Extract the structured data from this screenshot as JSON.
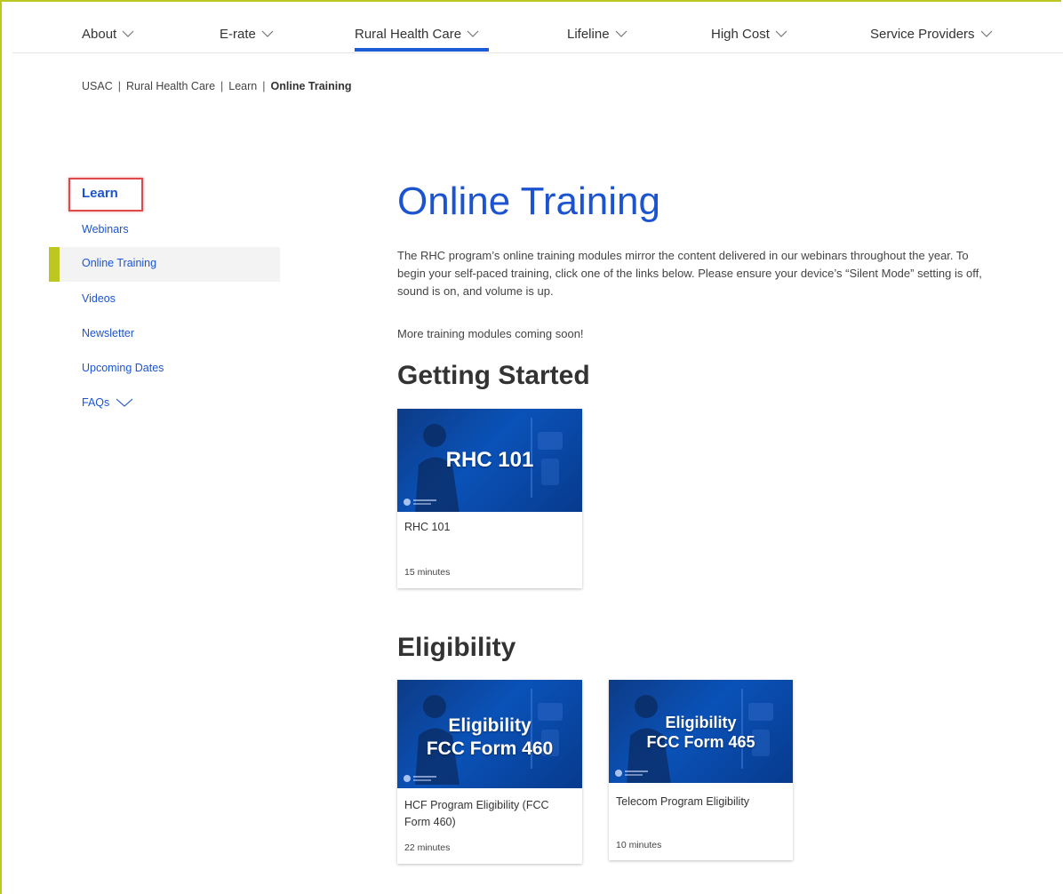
{
  "nav": {
    "items": [
      {
        "label": "About"
      },
      {
        "label": "E-rate"
      },
      {
        "label": "Rural Health Care"
      },
      {
        "label": "Lifeline"
      },
      {
        "label": "High Cost"
      },
      {
        "label": "Service Providers"
      }
    ],
    "active_index": 2
  },
  "breadcrumb": {
    "items": [
      "USAC",
      "Rural Health Care",
      "Learn"
    ],
    "separator": "|",
    "current": "Online Training"
  },
  "sidebar": {
    "heading": "Learn",
    "items": [
      {
        "label": "Webinars"
      },
      {
        "label": "Online Training"
      },
      {
        "label": "Videos"
      },
      {
        "label": "Newsletter"
      },
      {
        "label": "Upcoming Dates"
      },
      {
        "label": "FAQs"
      }
    ]
  },
  "main": {
    "title": "Online Training",
    "intro": "The RHC program’s online training modules mirror the content delivered in our webinars throughout the year. To begin your self-paced training, click one of the links below. Please ensure your device’s “Silent Mode” setting is off, sound is on, and volume is up.",
    "coming_soon": "More training modules coming soon!",
    "sections": [
      {
        "title": "Getting Started",
        "cards": [
          {
            "thumb_line1": "RHC 101",
            "thumb_line2": "",
            "label": "RHC 101",
            "duration": "15 minutes"
          }
        ]
      },
      {
        "title": "Eligibility",
        "cards": [
          {
            "thumb_line1": "Eligibility",
            "thumb_line2": "FCC Form 460",
            "label": "HCF Program Eligibility (FCC Form 460)",
            "duration": "22 minutes"
          },
          {
            "thumb_line1": "Eligibility",
            "thumb_line2": "FCC Form 465",
            "label": "Telecom Program Eligibility",
            "duration": "10 minutes"
          }
        ]
      }
    ]
  },
  "colors": {
    "link_blue": "#1c54d0",
    "accent_lime": "#bcc820",
    "nav_underline": "#1e5bd6",
    "highlight_red": "#e0494c",
    "thumb_blue": "#0a52b8"
  }
}
